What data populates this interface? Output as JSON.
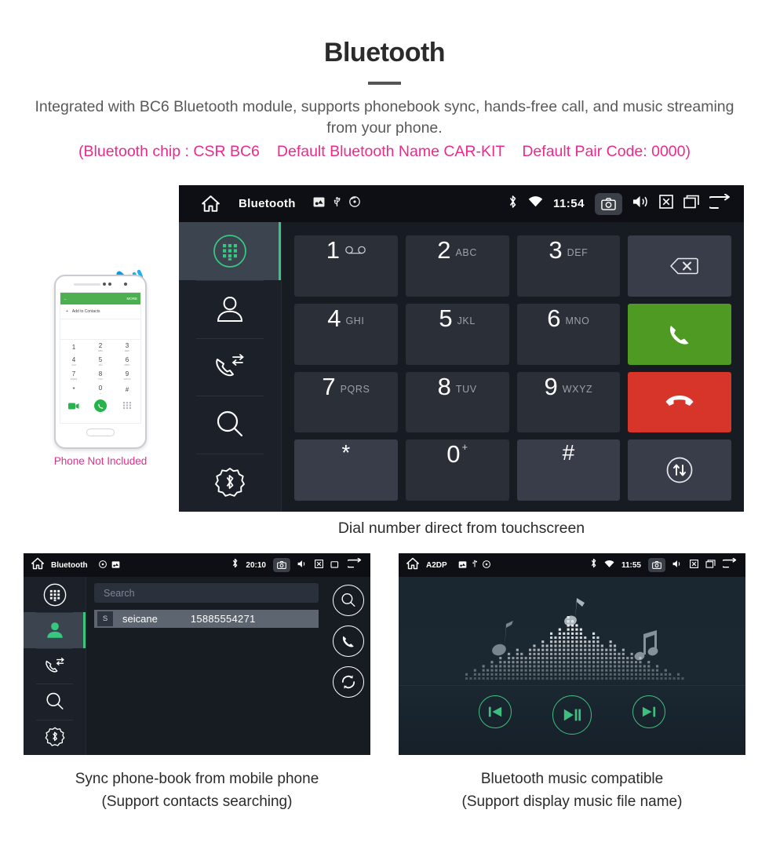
{
  "header": {
    "title": "Bluetooth",
    "subtitle": "Integrated with BC6 Bluetooth module, supports phonebook sync, hands-free call, and music streaming from your phone.",
    "spec_chip": "(Bluetooth chip : CSR BC6",
    "spec_name": "Default Bluetooth Name CAR-KIT",
    "spec_pair": "Default Pair Code: 0000)",
    "accent_pink": "#ec2a8c",
    "text_gray": "#58595b"
  },
  "main_screen": {
    "statusbar": {
      "title": "Bluetooth",
      "time": "11:54",
      "icons": {
        "home": "home-icon",
        "sd": "sd-card-icon",
        "usb": "usb-icon",
        "disc": "disc-icon",
        "bluetooth": "bluetooth-icon",
        "wifi": "wifi-icon",
        "camera": "camera-icon",
        "volume": "volume-icon",
        "mute": "mute-x-icon",
        "recents": "recents-icon",
        "back": "back-arrow-icon"
      }
    },
    "sidebar": [
      {
        "name": "dialpad",
        "label": "dialpad-icon",
        "active": true
      },
      {
        "name": "contacts",
        "label": "contacts-icon",
        "active": false
      },
      {
        "name": "call-history",
        "label": "call-history-icon",
        "active": false
      },
      {
        "name": "search",
        "label": "search-icon",
        "active": false
      },
      {
        "name": "bt-settings",
        "label": "bluetooth-settings-icon",
        "active": false
      }
    ],
    "keys": [
      {
        "num": "1",
        "sub": "",
        "icon": "voicemail-icon"
      },
      {
        "num": "2",
        "sub": "ABC"
      },
      {
        "num": "3",
        "sub": "DEF"
      },
      {
        "num": "4",
        "sub": "GHI"
      },
      {
        "num": "5",
        "sub": "JKL"
      },
      {
        "num": "6",
        "sub": "MNO"
      },
      {
        "num": "7",
        "sub": "PQRS"
      },
      {
        "num": "8",
        "sub": "TUV"
      },
      {
        "num": "9",
        "sub": "WXYZ"
      },
      {
        "num": "*",
        "sub": ""
      },
      {
        "num": "0",
        "sup": "+"
      },
      {
        "num": "#",
        "sub": ""
      }
    ],
    "actions": {
      "backspace": "backspace-icon",
      "call": "call-icon",
      "hangup": "hangup-icon",
      "transfer": "transfer-audio-icon",
      "call_color": "#4f9a22",
      "hangup_color": "#d7342a"
    },
    "caption": "Dial number direct from touchscreen"
  },
  "phone_mock": {
    "header_back": "←",
    "header_more": "MORE",
    "add_contacts": "Add to Contacts",
    "keys": [
      {
        "num": "1",
        "sub": ""
      },
      {
        "num": "2",
        "sub": "ABC"
      },
      {
        "num": "3",
        "sub": "DEF"
      },
      {
        "num": "4",
        "sub": "GHI"
      },
      {
        "num": "5",
        "sub": "JKL"
      },
      {
        "num": "6",
        "sub": "MNO"
      },
      {
        "num": "7",
        "sub": "PQRS"
      },
      {
        "num": "8",
        "sub": "TUV"
      },
      {
        "num": "9",
        "sub": "WXYZ"
      },
      {
        "num": "*",
        "sub": ""
      },
      {
        "num": "0",
        "sub": "+"
      },
      {
        "num": "#",
        "sub": ""
      }
    ],
    "note": "Phone Not Included"
  },
  "phonebook_screen": {
    "statusbar": {
      "title": "Bluetooth",
      "time": "20:10"
    },
    "search_placeholder": "Search",
    "contact": {
      "initial": "S",
      "name": "seicane",
      "number": "15885554271"
    },
    "actions": [
      "search-icon",
      "call-icon",
      "sync-icon"
    ],
    "caption_line1": "Sync phone-book from mobile phone",
    "caption_line2": "(Support contacts searching)"
  },
  "music_screen": {
    "statusbar": {
      "title": "A2DP",
      "time": "11:55"
    },
    "controls": [
      "previous-track",
      "play-pause",
      "next-track"
    ],
    "accent_green": "#3fbf7f",
    "caption_line1": "Bluetooth music compatible",
    "caption_line2": "(Support display music file name)"
  }
}
